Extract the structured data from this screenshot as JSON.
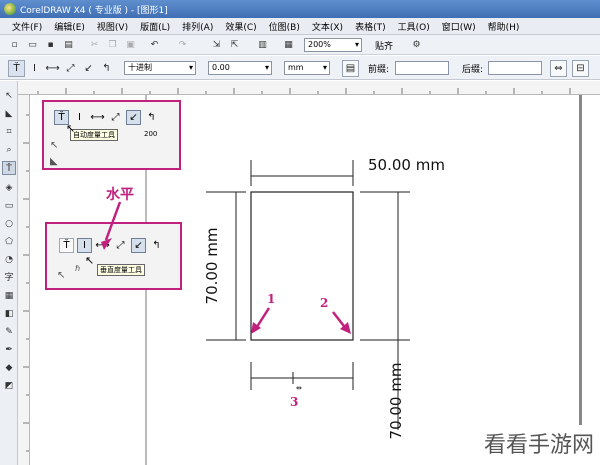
{
  "window": {
    "title": "CorelDRAW X4 ( 专业版 ) - [图形1]"
  },
  "menu": [
    "文件(F)",
    "编辑(E)",
    "视图(V)",
    "版面(L)",
    "排列(A)",
    "效果(C)",
    "位图(B)",
    "文本(X)",
    "表格(T)",
    "工具(O)",
    "窗口(W)",
    "帮助(H)"
  ],
  "toolbar": {
    "zoom": "200%",
    "snap": "贴齐"
  },
  "propbar": {
    "style": "十进制",
    "precision": "0.00",
    "unit": "mm",
    "prefix_label": "前缀:",
    "suffix_label": "后缀:"
  },
  "callout_top": {
    "tooltip": "自动度量工具",
    "ruler_tick": "200"
  },
  "callout_bottom": {
    "tooltip": "垂直度量工具"
  },
  "annotations": {
    "label": "水平",
    "n1": "1",
    "n2": "2",
    "n3": "3"
  },
  "dimensions": {
    "horizontal": "50.00 mm",
    "vertical_left": "70.00 mm",
    "vertical_right": "70.00 mm"
  },
  "watermark": "看看手游网"
}
